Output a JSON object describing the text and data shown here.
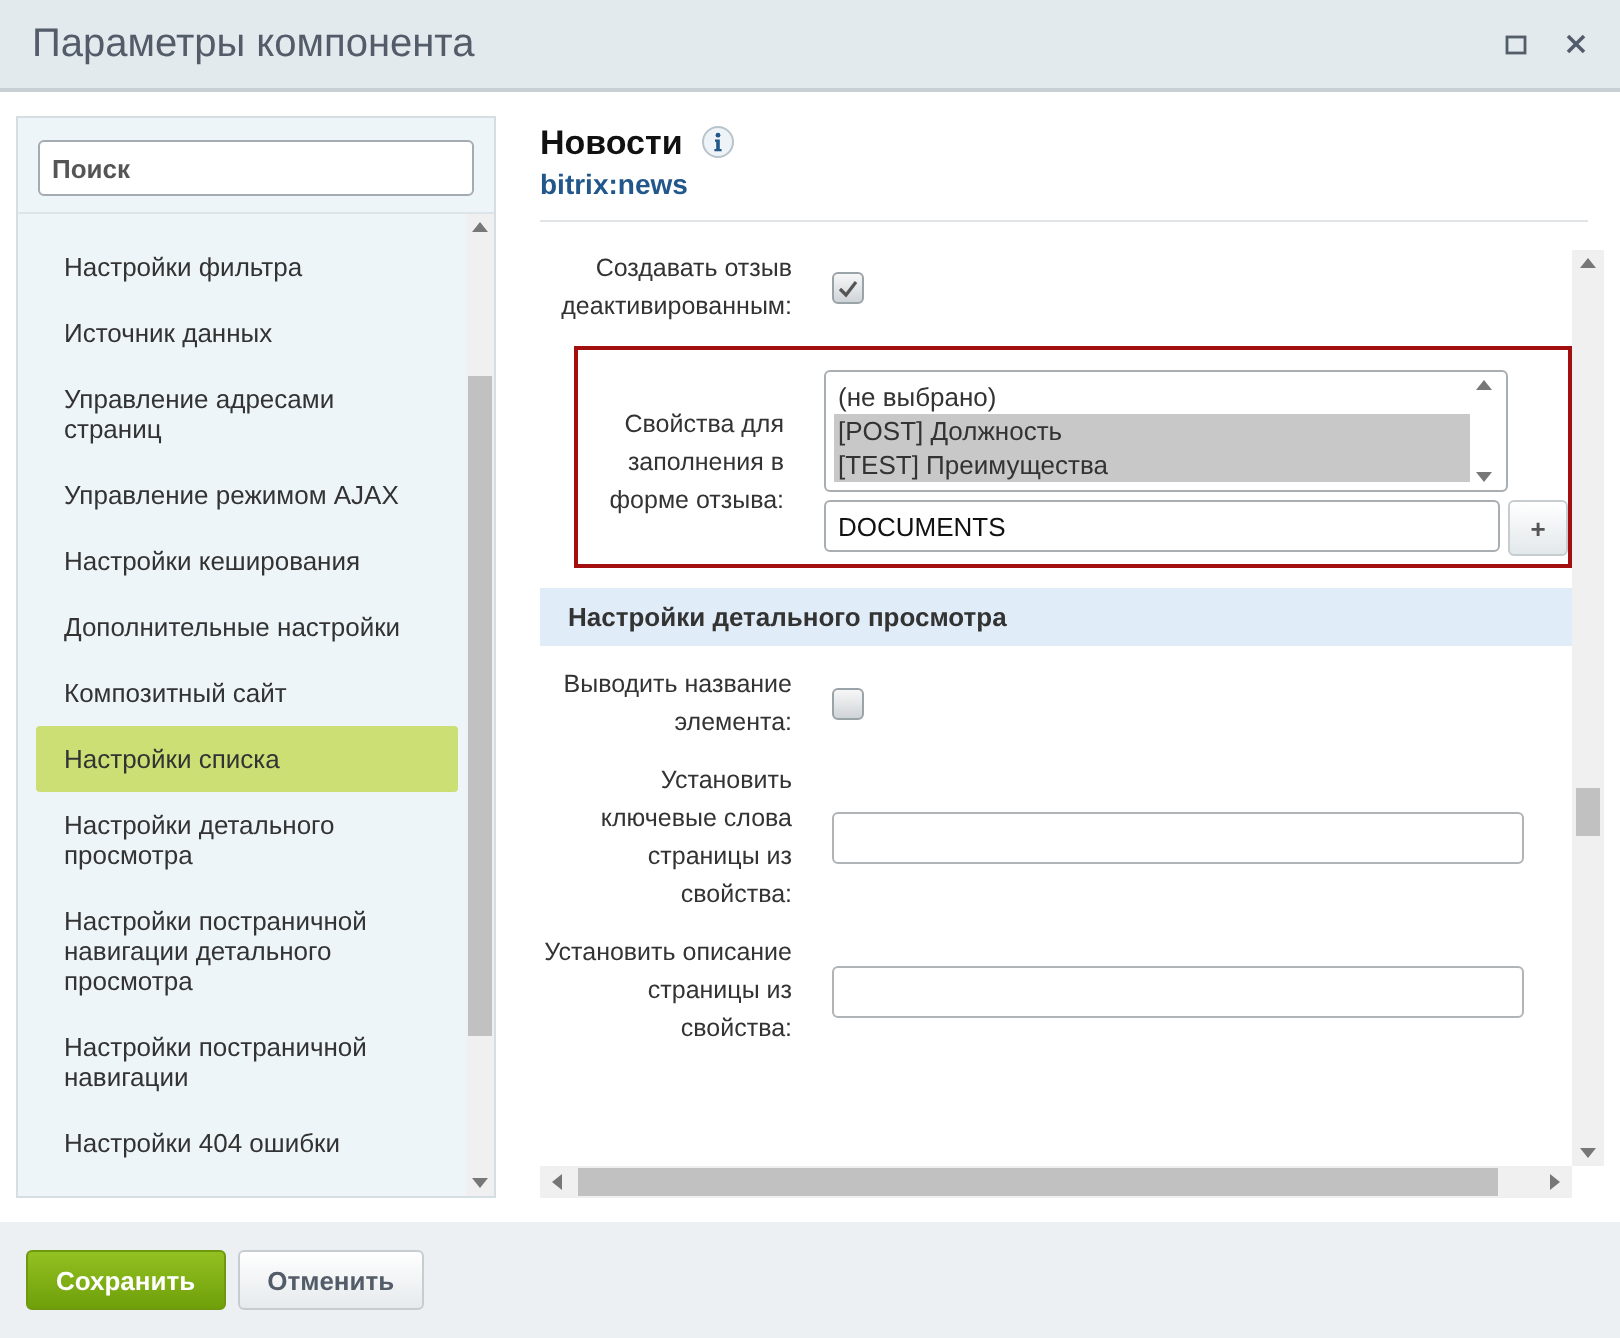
{
  "window": {
    "title": "Параметры компонента"
  },
  "sidebar": {
    "search": {
      "placeholder": "Поиск"
    },
    "items": [
      {
        "label": "Настройки фильтра",
        "selected": false
      },
      {
        "label": "Источник данных",
        "selected": false
      },
      {
        "label": "Управление адресами страниц",
        "selected": false
      },
      {
        "label": "Управление режимом AJAX",
        "selected": false
      },
      {
        "label": "Настройки кеширования",
        "selected": false
      },
      {
        "label": "Дополнительные настройки",
        "selected": false
      },
      {
        "label": "Композитный сайт",
        "selected": false
      },
      {
        "label": "Настройки списка",
        "selected": true
      },
      {
        "label": "Настройки детального просмотра",
        "selected": false
      },
      {
        "label": "Настройки постраничной навигации детального просмотра",
        "selected": false
      },
      {
        "label": "Настройки постраничной навигации",
        "selected": false
      },
      {
        "label": "Настройки 404 ошибки",
        "selected": false
      }
    ]
  },
  "component": {
    "name": "Новости",
    "code": "bitrix:news"
  },
  "fields": [
    {
      "kind": "checkbox",
      "label": "Создавать отзыв деактивированным:",
      "checked": true
    },
    {
      "kind": "multiselect",
      "label": "Свойства для заполнения в форме отзыва:",
      "highlighted": true,
      "options": [
        {
          "label": "(не выбрано)",
          "selected": false
        },
        {
          "label": "[POST] Должность",
          "selected": true
        },
        {
          "label": "[TEST] Преимущества",
          "selected": true
        }
      ],
      "extra_value": "DOCUMENTS",
      "add_label": "+"
    },
    {
      "kind": "section",
      "label": "Настройки детального просмотра"
    },
    {
      "kind": "checkbox",
      "label": "Выводить название элемента:",
      "checked": false
    },
    {
      "kind": "text",
      "label": "Установить ключевые слова страницы из свойства:"
    },
    {
      "kind": "text",
      "label": "Установить описание страницы из свойства:"
    }
  ],
  "buttons": [
    {
      "label": "Сохранить",
      "kind": "primary"
    },
    {
      "label": "Отменить",
      "kind": "secondary"
    }
  ]
}
